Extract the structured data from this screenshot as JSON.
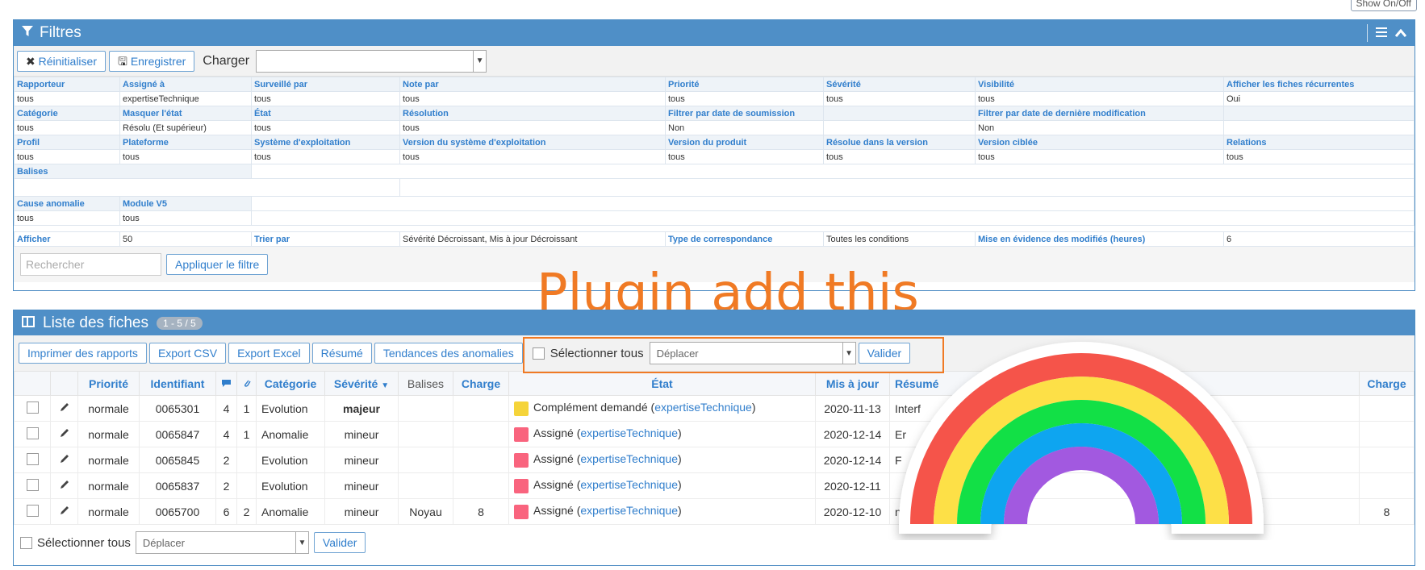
{
  "show_toggle": "Show On/Off",
  "filters": {
    "title": "Filtres",
    "reset_label": "Réinitialiser",
    "save_label": "Enregistrer",
    "load_label": "Charger",
    "load_value": "",
    "rows": [
      {
        "headers": [
          "Rapporteur",
          "Assigné à",
          "Surveillé par",
          "Note par",
          "Priorité",
          "Sévérité",
          "Visibilité",
          "Afficher les fiches récurrentes"
        ],
        "values": [
          "tous",
          "expertiseTechnique",
          "tous",
          "tous",
          "tous",
          "tous",
          "tous",
          "Oui"
        ]
      },
      {
        "headers": [
          "Catégorie",
          "Masquer l'état",
          "État",
          "Résolution",
          "Filtrer par date de soumission",
          "",
          "Filtrer par date de dernière modification",
          ""
        ],
        "values": [
          "tous",
          "Résolu (Et supérieur)",
          "tous",
          "tous",
          "Non",
          "",
          "Non",
          ""
        ]
      },
      {
        "headers": [
          "Profil",
          "Plateforme",
          "Système d'exploitation",
          "Version du système d'exploitation",
          "Version du produit",
          "Résolue dans la version",
          "Version ciblée",
          "Relations"
        ],
        "values": [
          "tous",
          "tous",
          "tous",
          "tous",
          "tous",
          "tous",
          "tous",
          "tous"
        ]
      }
    ],
    "balises_label": "Balises",
    "cause_label": "Cause anomalie",
    "module_label": "Module V5",
    "cause_value": "tous",
    "module_value": "tous",
    "afficher_label": "Afficher",
    "afficher_value": "50",
    "trier_label": "Trier par",
    "trier_value": "Sévérité Décroissant, Mis à jour Décroissant",
    "type_label": "Type de correspondance",
    "type_value": "Toutes les conditions",
    "mise_label": "Mise en évidence des modifiés (heures)",
    "mise_value": "6",
    "search_placeholder": "Rechercher",
    "apply_label": "Appliquer le filtre"
  },
  "annotation": "Plugin add this",
  "list": {
    "title": "Liste des fiches",
    "count": "1 - 5 / 5",
    "toolbar": [
      "Imprimer des rapports",
      "Export CSV",
      "Export Excel",
      "Résumé",
      "Tendances des anomalies"
    ],
    "select_all": "Sélectionner tous",
    "move_placeholder": "Déplacer",
    "validate": "Valider",
    "columns": [
      "Priorité",
      "Identifiant",
      "Catégorie",
      "Sévérité",
      "Balises",
      "Charge",
      "État",
      "Mis à jour",
      "Résumé",
      "Charge"
    ],
    "rows": [
      {
        "priority": "normale",
        "id": "0065301",
        "notes": "4",
        "files": "1",
        "category": "Evolution",
        "severity": "majeur",
        "tags": "",
        "charge": "",
        "state": "Complément demandé",
        "assignee": "expertiseTechnique",
        "state_color": "#f5d43a",
        "updated": "2020-11-13",
        "summary": "Interf",
        "charge2": ""
      },
      {
        "priority": "normale",
        "id": "0065847",
        "notes": "4",
        "files": "1",
        "category": "Anomalie",
        "severity": "mineur",
        "tags": "",
        "charge": "",
        "state": "Assigné",
        "assignee": "expertiseTechnique",
        "state_color": "#f9647e",
        "updated": "2020-12-14",
        "summary": "Er",
        "charge2": ""
      },
      {
        "priority": "normale",
        "id": "0065845",
        "notes": "2",
        "files": "",
        "category": "Evolution",
        "severity": "mineur",
        "tags": "",
        "charge": "",
        "state": "Assigné",
        "assignee": "expertiseTechnique",
        "state_color": "#f9647e",
        "updated": "2020-12-14",
        "summary": "F",
        "charge2": ""
      },
      {
        "priority": "normale",
        "id": "0065837",
        "notes": "2",
        "files": "",
        "category": "Evolution",
        "severity": "mineur",
        "tags": "",
        "charge": "",
        "state": "Assigné",
        "assignee": "expertiseTechnique",
        "state_color": "#f9647e",
        "updated": "2020-12-11",
        "summary": "",
        "charge2": ""
      },
      {
        "priority": "normale",
        "id": "0065700",
        "notes": "6",
        "files": "2",
        "category": "Anomalie",
        "severity": "mineur",
        "tags": "Noyau",
        "charge": "8",
        "state": "Assigné",
        "assignee": "expertiseTechnique",
        "state_color": "#f9647e",
        "updated": "2020-12-10",
        "summary": "niné : filtre coc",
        "charge2": "8"
      }
    ]
  },
  "colors": {
    "header_blue": "#4f8fc7",
    "link": "#307ecc",
    "accent": "#f07a24"
  }
}
